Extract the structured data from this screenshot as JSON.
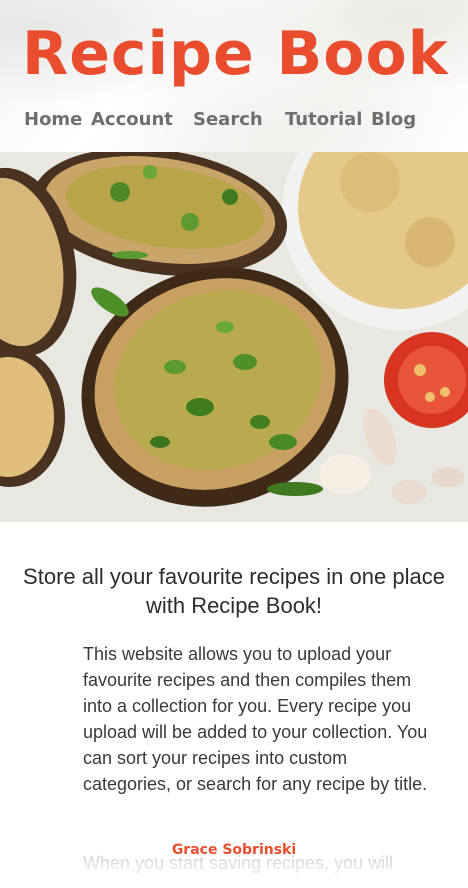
{
  "header": {
    "brand": "Recipe Book",
    "nav": [
      {
        "label": "Home"
      },
      {
        "label": "Account"
      },
      {
        "label": "Search"
      },
      {
        "label": "Tutorial"
      },
      {
        "label": "Blog"
      }
    ]
  },
  "colors": {
    "accent": "#e94d2e",
    "nav_text": "#6f6f6f"
  },
  "main": {
    "headline": "Store all your favourite recipes in one place with Recipe Book!",
    "body": "This website allows you to upload your favourite recipes and then compiles them into a collection for you. Every recipe you upload will be added to your collection. You can sort your recipes into custom categories, or search for any recipe by title.",
    "author": "Grace Sobrinski",
    "continued_text": "When you start saving recipes, you will"
  }
}
